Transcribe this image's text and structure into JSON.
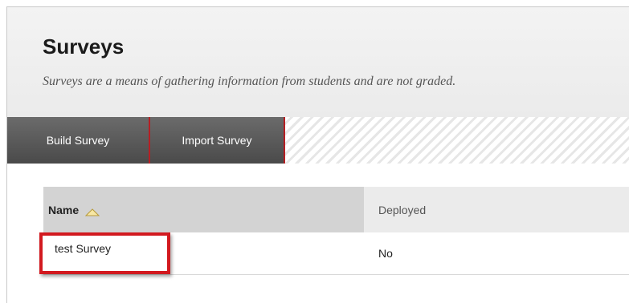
{
  "header": {
    "title": "Surveys",
    "subtitle": "Surveys are a means of gathering information from students and are not graded."
  },
  "actionbar": {
    "buttons": [
      {
        "label": "Build Survey"
      },
      {
        "label": "Import Survey"
      }
    ]
  },
  "table": {
    "columns": [
      {
        "label": "Name",
        "sort": "ascending",
        "icon": "sort-ascending-icon"
      },
      {
        "label": "Deployed"
      }
    ],
    "rows": [
      {
        "name": "test Survey",
        "deployed": "No"
      }
    ]
  },
  "colors": {
    "accent": "#b51f24",
    "highlight": "#d2191f",
    "button_bg": "#5a5a5a"
  }
}
